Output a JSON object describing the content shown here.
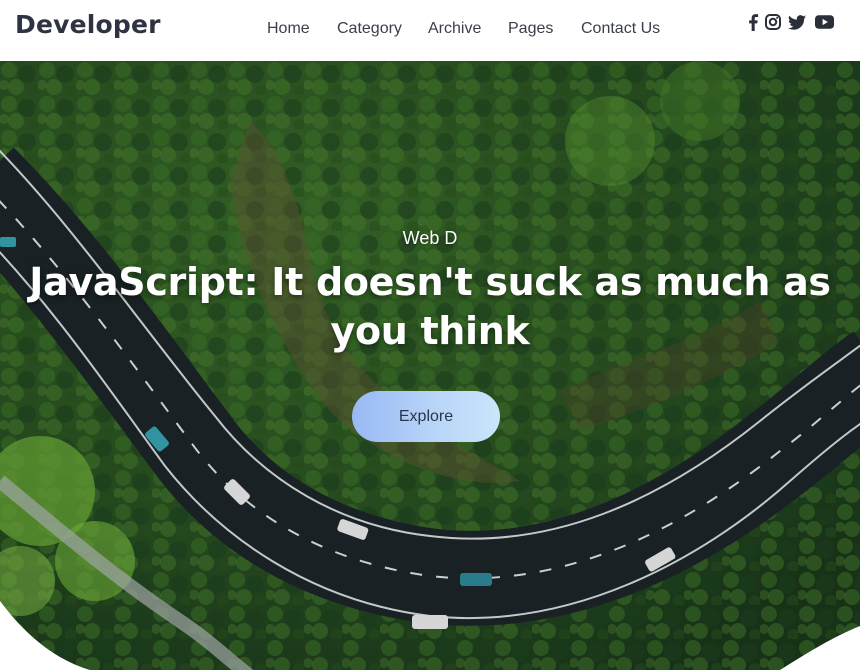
{
  "header": {
    "logo": "Developer",
    "nav": [
      {
        "label": "Home"
      },
      {
        "label": "Category"
      },
      {
        "label": "Archive"
      },
      {
        "label": "Pages"
      },
      {
        "label": "Contact Us"
      }
    ],
    "social": [
      {
        "icon": "facebook-icon"
      },
      {
        "icon": "instagram-icon"
      },
      {
        "icon": "twitter-icon"
      },
      {
        "icon": "youtube-icon"
      }
    ]
  },
  "hero": {
    "category": "Web D",
    "title": "JavaScript: It doesn't suck as much as you think",
    "button_label": "Explore",
    "colors": {
      "forest": "#2f5a26",
      "road": "#1f2a30",
      "button_gradient_start": "#98b9f4",
      "button_gradient_end": "#c9e6fb"
    }
  }
}
